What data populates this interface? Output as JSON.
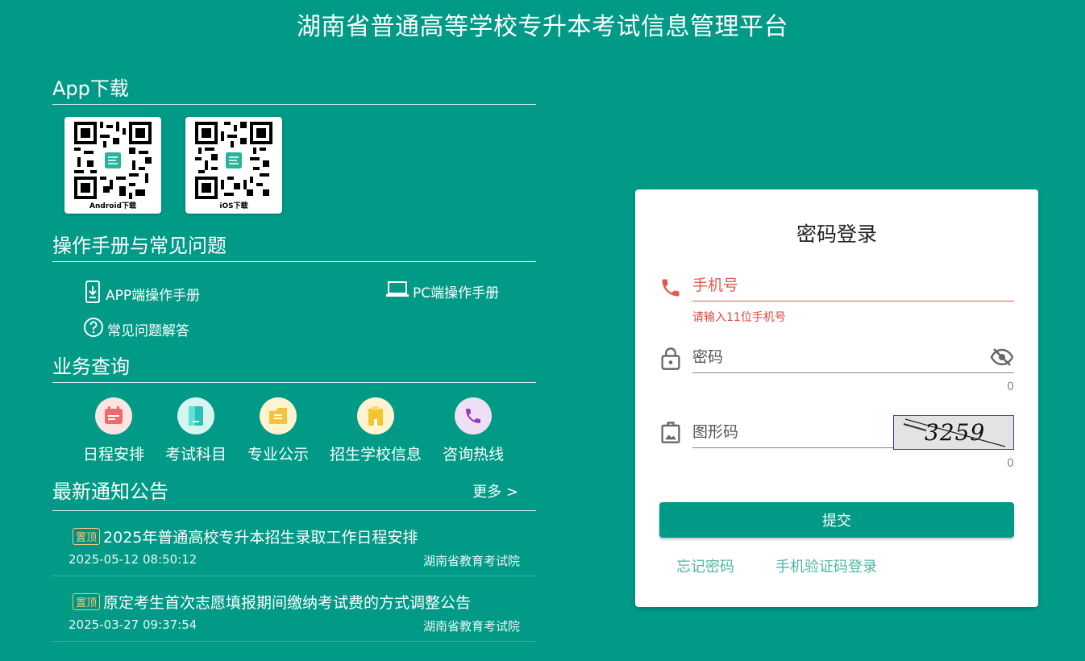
{
  "header": {
    "title": "湖南省普通高等学校专升本考试信息管理平台"
  },
  "app_download": {
    "heading": "App下载",
    "android_caption": "Android下载",
    "ios_caption": "iOS下载"
  },
  "manuals": {
    "heading": "操作手册与常见问题",
    "app_manual": "APP端操作手册",
    "pc_manual": "PC端操作手册",
    "faq": "常见问题解答"
  },
  "services": {
    "heading": "业务查询",
    "items": [
      {
        "label": "日程安排",
        "icon": "calendar-icon",
        "bg": "#fde3e2",
        "color": "#ef6a6a"
      },
      {
        "label": "考试科目",
        "icon": "document-icon",
        "bg": "#d6f5f1",
        "color": "#26c2b2"
      },
      {
        "label": "专业公示",
        "icon": "folder-icon",
        "bg": "#fff4cf",
        "color": "#f5c531"
      },
      {
        "label": "招生学校信息",
        "icon": "building-icon",
        "bg": "#fff4cf",
        "color": "#f5c531"
      },
      {
        "label": "咨询热线",
        "icon": "phone-icon",
        "bg": "#efdff5",
        "color": "#9a3ab8"
      }
    ]
  },
  "notices": {
    "heading": "最新通知公告",
    "more": "更多 >",
    "items": [
      {
        "badge": "置顶",
        "title": "2025年普通高校专升本招生录取工作日程安排",
        "date": "2025-05-12 08:50:12",
        "source": "湖南省教育考试院"
      },
      {
        "badge": "置顶",
        "title": "原定考生首次志愿填报期间缴纳考试费的方式调整公告",
        "date": "2025-03-27 09:37:54",
        "source": "湖南省教育考试院"
      }
    ]
  },
  "login": {
    "title": "密码登录",
    "phone_placeholder": "手机号",
    "phone_error": "请输入11位手机号",
    "password_placeholder": "密码",
    "password_counter": "0",
    "captcha_placeholder": "图形码",
    "captcha_counter": "0",
    "captcha_text": "3259",
    "submit": "提交",
    "forgot": "忘记密码",
    "sms_login": "手机验证码登录"
  },
  "colors": {
    "brand": "#009a87",
    "error": "#e0463a",
    "link": "#4fb6a7"
  }
}
